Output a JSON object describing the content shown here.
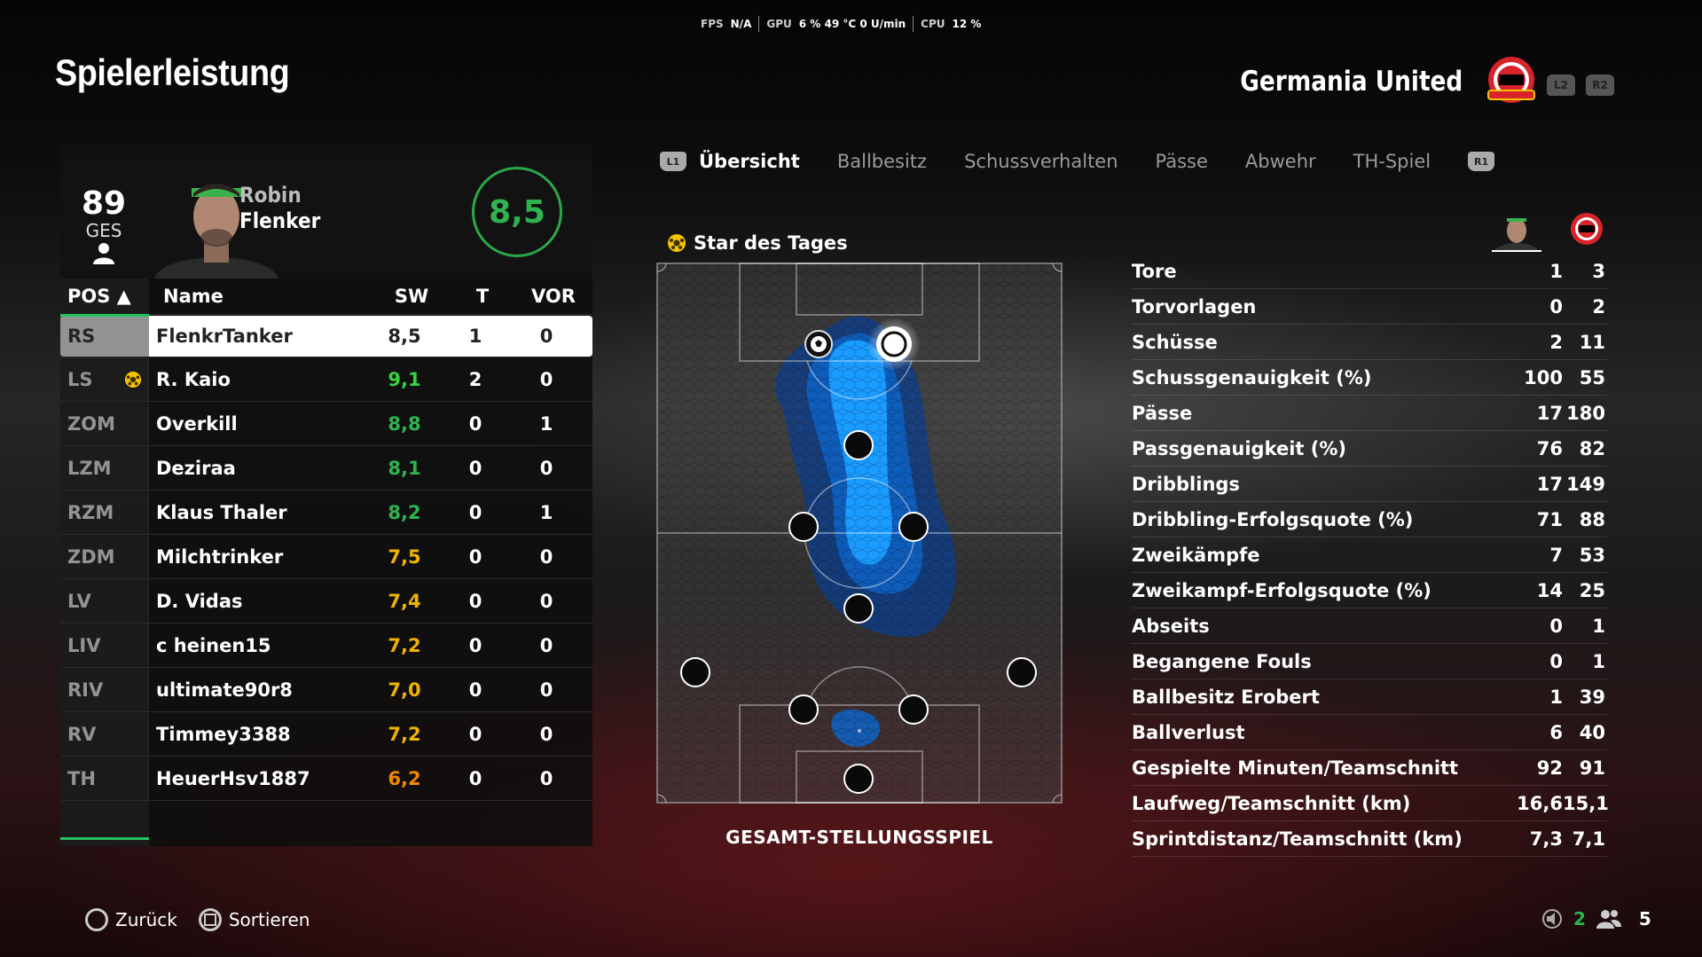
{
  "perf": {
    "fps_label": "FPS",
    "fps_value": "N/A",
    "gpu_label": "GPU",
    "gpu_value": "6 %  49 °C  0 U/min",
    "cpu_label": "CPU",
    "cpu_value": "12 %"
  },
  "title": "Spielerleistung",
  "team": {
    "name": "Germania United",
    "l2": "L2",
    "r2": "R2"
  },
  "player": {
    "overall": "89",
    "overall_label": "GES",
    "first_name": "Robin",
    "last_name": "Flenker",
    "rating": "8,5"
  },
  "table": {
    "headers": {
      "pos": "POS ▲",
      "name": "Name",
      "sw": "SW",
      "t": "T",
      "vor": "VOR"
    },
    "rows": [
      {
        "pos": "RS",
        "name": "FlenkrTanker",
        "sw": "8,5",
        "t": "1",
        "vor": "0",
        "color": "#222222",
        "motm": false
      },
      {
        "pos": "LS",
        "name": "R. Kaio",
        "sw": "9,1",
        "t": "2",
        "vor": "0",
        "color": "#35d23f",
        "motm": true
      },
      {
        "pos": "ZOM",
        "name": "Overkill",
        "sw": "8,8",
        "t": "0",
        "vor": "1",
        "color": "#2fb24f",
        "motm": false
      },
      {
        "pos": "LZM",
        "name": "Deziraa",
        "sw": "8,1",
        "t": "0",
        "vor": "0",
        "color": "#2fb24f",
        "motm": false
      },
      {
        "pos": "RZM",
        "name": "Klaus Thaler",
        "sw": "8,2",
        "t": "0",
        "vor": "1",
        "color": "#2fb24f",
        "motm": false
      },
      {
        "pos": "ZDM",
        "name": "Milchtrinker",
        "sw": "7,5",
        "t": "0",
        "vor": "0",
        "color": "#f0b400",
        "motm": false
      },
      {
        "pos": "LV",
        "name": "D. Vidas",
        "sw": "7,4",
        "t": "0",
        "vor": "0",
        "color": "#f0b400",
        "motm": false
      },
      {
        "pos": "LIV",
        "name": "c heinen15",
        "sw": "7,2",
        "t": "0",
        "vor": "0",
        "color": "#f0b400",
        "motm": false
      },
      {
        "pos": "RIV",
        "name": "ultimate90r8",
        "sw": "7,0",
        "t": "0",
        "vor": "0",
        "color": "#f0b400",
        "motm": false
      },
      {
        "pos": "RV",
        "name": "Timmey3388",
        "sw": "7,2",
        "t": "0",
        "vor": "0",
        "color": "#f0b400",
        "motm": false
      },
      {
        "pos": "TH",
        "name": "HeuerHsv1887",
        "sw": "6,2",
        "t": "0",
        "vor": "0",
        "color": "#f08a00",
        "motm": false
      }
    ]
  },
  "tabs": {
    "l1": "L1",
    "r1": "R1",
    "items": [
      "Übersicht",
      "Ballbesitz",
      "Schussverhalten",
      "Pässe",
      "Abwehr",
      "TH-Spiel"
    ],
    "active": 0
  },
  "star_label": "Star des Tages",
  "pitch_caption": "GESAMT-STELLUNGSSPIEL",
  "stats": [
    {
      "label": "Tore",
      "player": "1",
      "team": "3"
    },
    {
      "label": "Torvorlagen",
      "player": "0",
      "team": "2"
    },
    {
      "label": "Schüsse",
      "player": "2",
      "team": "11"
    },
    {
      "label": "Schussgenauigkeit (%)",
      "player": "100",
      "team": "55"
    },
    {
      "label": "Pässe",
      "player": "17",
      "team": "180"
    },
    {
      "label": "Passgenauigkeit (%)",
      "player": "76",
      "team": "82"
    },
    {
      "label": "Dribblings",
      "player": "17",
      "team": "149"
    },
    {
      "label": "Dribbling-Erfolgsquote (%)",
      "player": "71",
      "team": "88"
    },
    {
      "label": "Zweikämpfe",
      "player": "7",
      "team": "53"
    },
    {
      "label": "Zweikampf-Erfolgsquote (%)",
      "player": "14",
      "team": "25"
    },
    {
      "label": "Abseits",
      "player": "0",
      "team": "1"
    },
    {
      "label": "Begangene Fouls",
      "player": "0",
      "team": "1"
    },
    {
      "label": "Ballbesitz Erobert",
      "player": "1",
      "team": "39"
    },
    {
      "label": "Ballverlust",
      "player": "6",
      "team": "40"
    },
    {
      "label": "Gespielte Minuten/Teamschnitt",
      "player": "92",
      "team": "91"
    },
    {
      "label": "Laufweg/Teamschnitt (km)",
      "player": "16,6",
      "team": "15,1"
    },
    {
      "label": "Sprintdistanz/Teamschnitt (km)",
      "player": "7,3",
      "team": "7,1"
    }
  ],
  "bottom": {
    "back": "Zurück",
    "sort": "Sortieren",
    "count_a": "2",
    "count_b": "5"
  },
  "colors": {
    "accent_green": "#23c45e",
    "heat_blue": "#1a9bff",
    "crest_red": "#d8232a"
  }
}
